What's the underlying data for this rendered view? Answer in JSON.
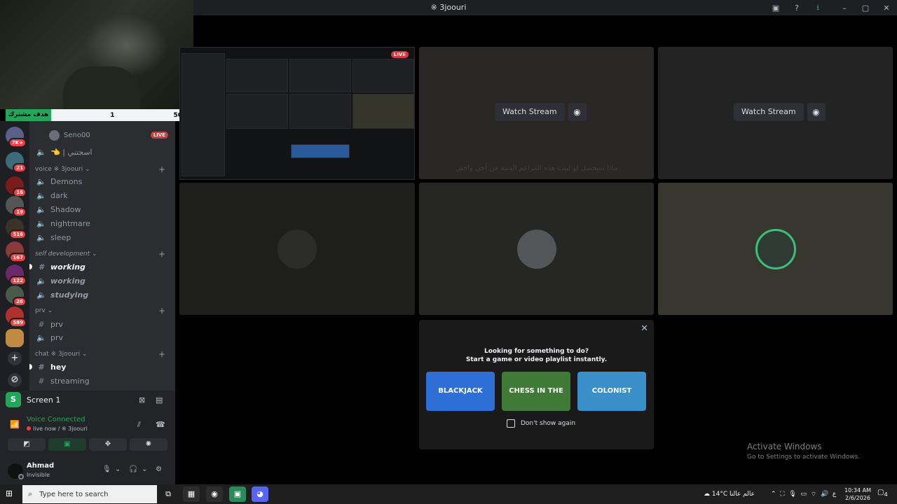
{
  "window": {
    "title": "※ 3joouri",
    "icons": [
      "screen-icon",
      "help-icon",
      "download-icon",
      "minimize-icon",
      "maximize-icon",
      "close-icon"
    ]
  },
  "goal_bar": {
    "tag": "هدف مشترك",
    "current": "1",
    "target": "50"
  },
  "server_badges": [
    "7K+",
    "21",
    "16",
    "19",
    "516",
    "167",
    "122",
    "26",
    "589"
  ],
  "channels": {
    "voice_users": [
      {
        "name": "Seno00",
        "live": "LIVE"
      }
    ],
    "top_voice": "👈 | اسجتني",
    "categories": [
      {
        "name": "voice ※ 3joouri",
        "channels": [
          "Demons",
          "dark",
          "Shadow",
          "nightmare",
          "sleep"
        ]
      },
      {
        "name": "self development",
        "channels": [
          "working",
          "working",
          "studying"
        ]
      },
      {
        "name": "prv",
        "channels": [
          "prv",
          "prv"
        ]
      },
      {
        "name": "chat ※ 3joouri",
        "channels": [
          "hey",
          "streaming"
        ]
      }
    ]
  },
  "panel": {
    "screen_label": "Screen 1",
    "voice_status": "Voice Connected",
    "voice_sub": "live now / ※ 3joouri",
    "username": "Ahmad",
    "user_status": "Invisible"
  },
  "stream": {
    "live": "LIVE",
    "watch_label": "Watch Stream",
    "caption": "ماذا سيحصل لو لبنت هذه المراعم الدنية عن أخي واختي"
  },
  "activity": {
    "line1": "Looking for something to do?",
    "line2": "Start a game or video playlist instantly.",
    "games": [
      "BLACKJACK",
      "CHESS IN THE PARK",
      "COLONIST"
    ],
    "dont_show": "Don't show again"
  },
  "activate_windows": {
    "title": "Activate Windows",
    "subtitle": "Go to Settings to activate Windows."
  },
  "taskbar": {
    "search_placeholder": "Type here to search",
    "weather": "14°C عالم عالنا",
    "lang": "ع",
    "time": "10:34 AM",
    "date": "2/6/2026",
    "notif_count": "4"
  },
  "colors": {
    "accent_green": "#23a55a",
    "live_red": "#da373c",
    "blurple": "#5865f2"
  }
}
